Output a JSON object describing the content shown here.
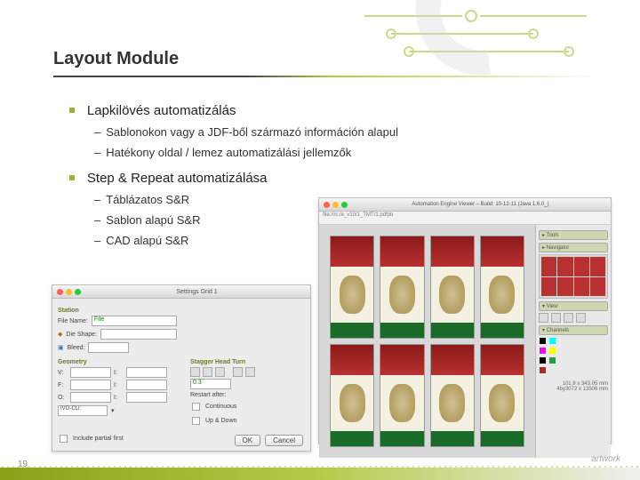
{
  "title": "Layout Module",
  "bullets": [
    {
      "text": "Lapkilövés automatizálás",
      "sub": [
        "Sablonokon vagy a JDF-ből származó információn alapul",
        "Hatékony oldal / lemez automatizálási jellemzők"
      ]
    },
    {
      "text": "Step & Repeat automatizálása",
      "sub": [
        "Táblázatos S&R",
        "Sablon alapú S&R",
        "CAD alapú S&R"
      ]
    }
  ],
  "dialog_left": {
    "title": "Settings Grid 1",
    "section1": "Station",
    "file_label": "File Name:",
    "file_value": "File",
    "shape_label": "Die Shape:",
    "bleed_label": "Bleed:",
    "section2": "Geometry",
    "section3": "Stagger Head Turn",
    "stagger_value": "0.3",
    "chk1": "Continuous",
    "chk2": "Up & Down",
    "restart_label": "Restart after:",
    "include_label": "Include partial first",
    "btn_ok": "OK",
    "btn_cancel": "Cancel"
  },
  "viewer_right": {
    "title": "Automation Engine Viewer – Build: 10-12-11 (Java 1.6.0_)",
    "file_path": "file:///c:/e_v10/1_TMT/1.pdfpb",
    "panels": {
      "tools": "Tools",
      "navigator": "Navigator",
      "view": "View",
      "channels": "Channels"
    },
    "channels_list": [
      "",
      "",
      "",
      "",
      "",
      "",
      ""
    ],
    "info_line1": "101.9 x 343.05 mm",
    "info_line2": "4by3072 x 13506 mm"
  },
  "page_number": "19",
  "footer_brand": "artwork"
}
